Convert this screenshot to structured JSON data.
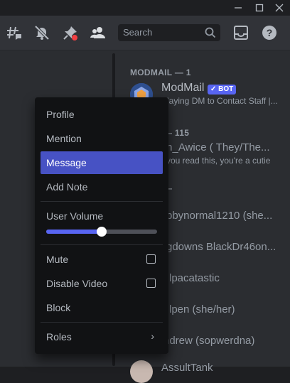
{
  "window": {
    "minimize": "—",
    "maximize": "☐",
    "close": "✕"
  },
  "toolbar": {
    "icons": [
      "threads-icon",
      "mute-bell-icon",
      "pin-icon",
      "members-icon",
      "inbox-icon",
      "help-icon"
    ],
    "search_placeholder": "Search"
  },
  "members": {
    "modmail_category": "MODMAIL — 1",
    "modmail": {
      "name": "ModMail",
      "badge": "✓ BOT",
      "status": "Playing DM to Contact Staff |..."
    },
    "category2_count": "— 115",
    "member1": {
      "name": "th_Awice ( They/The...",
      "status": "you read this, you're a cutie"
    },
    "category3_suffix": "—",
    "rows": [
      "bbynormal1210 (she...",
      "gdowns BlackDr46on...",
      "lpacatastic",
      "lpen (she/her)",
      "ndrew (sopwerdna)",
      "AssultTank"
    ]
  },
  "context_menu": {
    "profile": "Profile",
    "mention": "Mention",
    "message": "Message",
    "add_note": "Add Note",
    "user_volume": "User Volume",
    "volume_percent": 50,
    "mute": "Mute",
    "disable_video": "Disable Video",
    "block": "Block",
    "roles": "Roles"
  },
  "colors": {
    "accent": "#5865f2",
    "active": "#4752c4",
    "menu_bg": "#111214",
    "bot_badge": "#5865f2",
    "unread_red": "#f23f43"
  }
}
